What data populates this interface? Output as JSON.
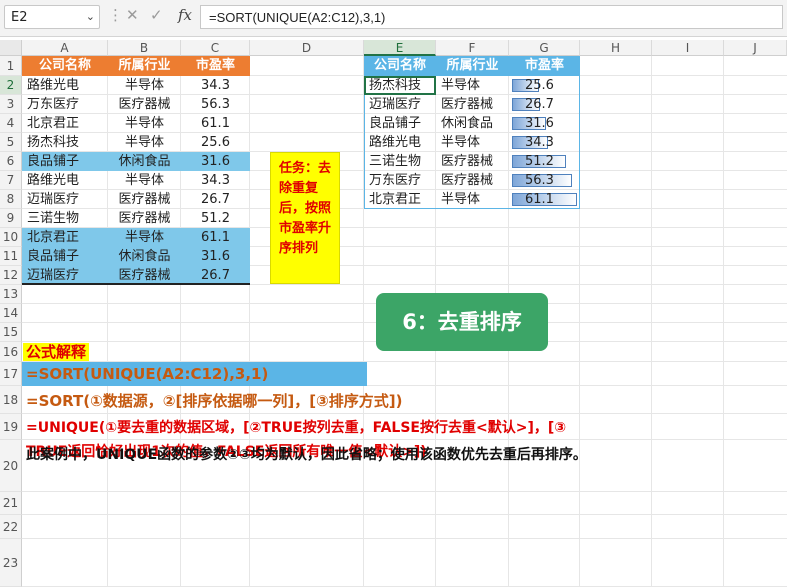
{
  "formula_bar": {
    "name_box": "E2",
    "formula": "=SORT(UNIQUE(A2:C12),3,1)"
  },
  "columns": [
    "A",
    "B",
    "C",
    "D",
    "E",
    "F",
    "G",
    "H",
    "I",
    "J"
  ],
  "rows": [
    "1",
    "2",
    "3",
    "4",
    "5",
    "6",
    "7",
    "8",
    "9",
    "10",
    "11",
    "12",
    "13",
    "14",
    "15",
    "16",
    "17",
    "18",
    "19",
    "20",
    "21",
    "22",
    "23"
  ],
  "source_table": {
    "headers": [
      "公司名称",
      "所属行业",
      "市盈率"
    ],
    "rows": [
      [
        "路维光电",
        "半导体",
        "34.3"
      ],
      [
        "万东医疗",
        "医疗器械",
        "56.3"
      ],
      [
        "北京君正",
        "半导体",
        "61.1"
      ],
      [
        "扬杰科技",
        "半导体",
        "25.6"
      ],
      [
        "良品铺子",
        "休闲食品",
        "31.6"
      ],
      [
        "路维光电",
        "半导体",
        "34.3"
      ],
      [
        "迈瑞医疗",
        "医疗器械",
        "26.7"
      ],
      [
        "三诺生物",
        "医疗器械",
        "51.2"
      ],
      [
        "北京君正",
        "半导体",
        "61.1"
      ],
      [
        "良品铺子",
        "休闲食品",
        "31.6"
      ],
      [
        "迈瑞医疗",
        "医疗器械",
        "26.7"
      ]
    ],
    "highlight_rows": [
      6,
      10,
      11,
      12
    ]
  },
  "result_table": {
    "headers": [
      "公司名称",
      "所属行业",
      "市盈率"
    ],
    "rows": [
      [
        "扬杰科技",
        "半导体",
        "25.6"
      ],
      [
        "迈瑞医疗",
        "医疗器械",
        "26.7"
      ],
      [
        "良品铺子",
        "休闲食品",
        "31.6"
      ],
      [
        "路维光电",
        "半导体",
        "34.3"
      ],
      [
        "三诺生物",
        "医疗器械",
        "51.2"
      ],
      [
        "万东医疗",
        "医疗器械",
        "56.3"
      ],
      [
        "北京君正",
        "半导体",
        "61.1"
      ]
    ],
    "bar_values": [
      25.6,
      26.7,
      31.6,
      34.3,
      51.2,
      56.3,
      61.1
    ],
    "bar_max": 61.1
  },
  "task_note": "任务：去除重复后，按照市盈率升序排列",
  "badge": "6：去重排序",
  "explanation": {
    "title": "公式解释",
    "formula": "=SORT(UNIQUE(A2:C12),3,1)",
    "sort_syntax": "=SORT(①数据源，②[排序依据哪一列]，[③排序方式])",
    "unique_line1": "=UNIQUE(①要去重的数据区域，[②TRUE按列去重，FALSE按行去重<默认>]，[③",
    "unique_line2": "TRUE返回恰好出现1次的值，FALSE返回所有唯一值<默认>])",
    "note": "此案例中，UNIQUE函数的参数②③均为默认，因此省略；使用该函数优先去重后再排序。"
  },
  "colors": {
    "source_header": "#ed7d31",
    "result_header": "#5bb5e6",
    "highlight": "#7fc8ea",
    "task_bg": "#ffff00",
    "badge_bg": "#3ca567",
    "brown_text": "#c55a11",
    "red_text": "#e00000"
  }
}
